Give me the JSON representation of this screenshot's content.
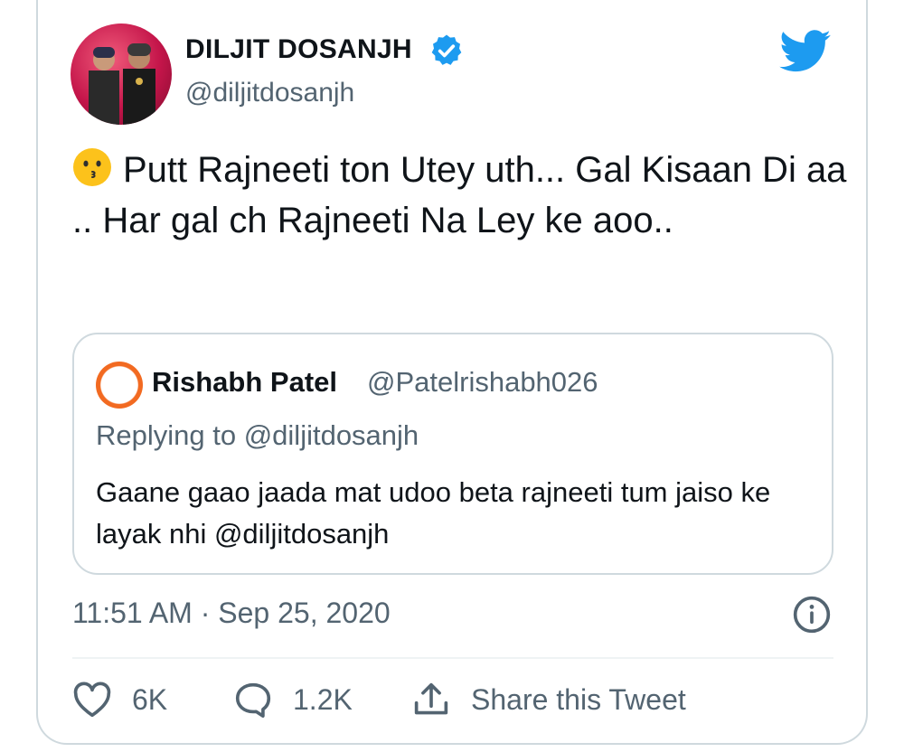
{
  "tweet": {
    "author": {
      "name": "DILJIT DOSANJH",
      "handle": "@diljitdosanjh",
      "verified": true
    },
    "text": "Putt Rajneeti ton Utey uth... Gal Kisaan Di aa .. Har gal ch Rajneeti Na Ley ke aoo..",
    "timestamp": "11:51 AM · Sep 25, 2020"
  },
  "quoted": {
    "name": "Rishabh Patel",
    "handle": "@Patelrishabh026",
    "replying_to": "Replying to @diljitdosanjh",
    "text": "Gaane gaao jaada mat udoo beta rajneeti tum jaiso ke layak nhi @diljitdosanjh"
  },
  "actions": {
    "likes": "6K",
    "replies": "1.2K",
    "share_label": "Share this Tweet"
  },
  "colors": {
    "brand": "#1d9bf0",
    "secondary_text": "#536471",
    "border": "#cfd9de"
  },
  "icons": [
    "verified-badge-icon",
    "twitter-bird-icon",
    "kissing-face-emoji",
    "info-icon",
    "heart-icon",
    "reply-icon",
    "share-icon"
  ]
}
